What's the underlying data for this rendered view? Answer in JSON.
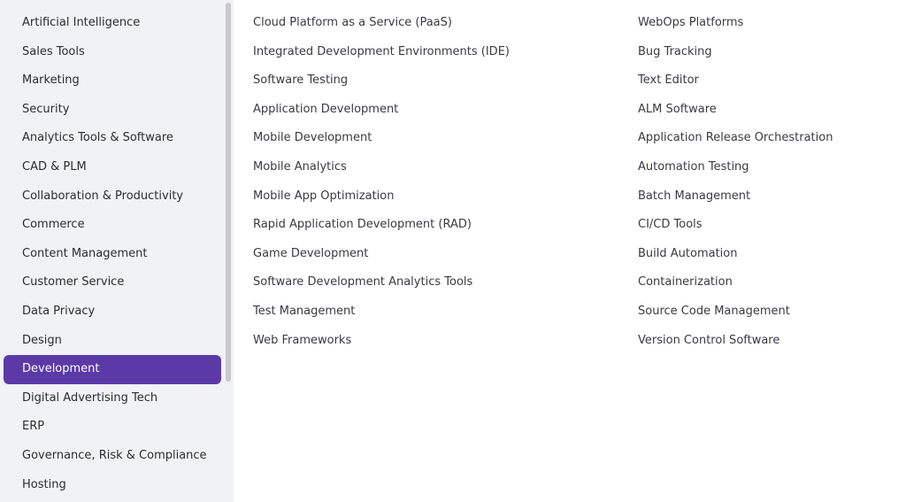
{
  "sidebar": {
    "items": [
      {
        "label": "Artificial Intelligence"
      },
      {
        "label": "Sales Tools"
      },
      {
        "label": "Marketing"
      },
      {
        "label": "Security"
      },
      {
        "label": "Analytics Tools & Software"
      },
      {
        "label": "CAD & PLM"
      },
      {
        "label": "Collaboration & Productivity"
      },
      {
        "label": "Commerce"
      },
      {
        "label": "Content Management"
      },
      {
        "label": "Customer Service"
      },
      {
        "label": "Data Privacy"
      },
      {
        "label": "Design"
      },
      {
        "label": "Development",
        "active": true
      },
      {
        "label": "Digital Advertising Tech"
      },
      {
        "label": "ERP"
      },
      {
        "label": "Governance, Risk & Compliance"
      },
      {
        "label": "Hosting"
      }
    ]
  },
  "content": {
    "column_1": [
      "Cloud Platform as a Service (PaaS)",
      "Integrated Development Environments (IDE)",
      "Software Testing",
      "Application Development",
      "Mobile Development",
      "Mobile Analytics",
      "Mobile App Optimization",
      "Rapid Application Development (RAD)",
      "Game Development",
      "Software Development Analytics Tools",
      "Test Management",
      "Web Frameworks"
    ],
    "column_2": [
      "WebOps Platforms",
      "Bug Tracking",
      "Text Editor",
      "ALM Software",
      "Application Release Orchestration",
      "Automation Testing",
      "Batch Management",
      "CI/CD Tools",
      "Build Automation",
      "Containerization",
      "Source Code Management",
      "Version Control Software"
    ]
  },
  "colors": {
    "active_background": "#5b3aa8",
    "sidebar_background": "#f1f2f5"
  }
}
